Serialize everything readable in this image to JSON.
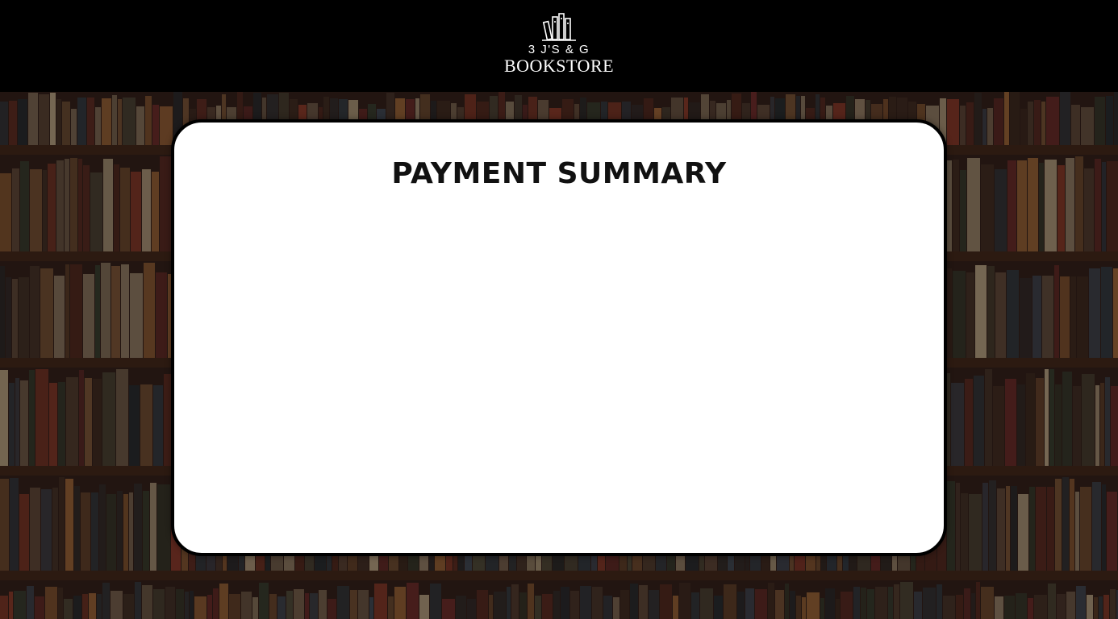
{
  "header": {
    "logo_icon": "books-icon",
    "logo_line1": "3 J'S & G",
    "logo_line2": "BOOKSTORE"
  },
  "background": {
    "subject": "bookshelves-photo"
  },
  "summary_card": {
    "title": "PAYMENT SUMMARY"
  }
}
